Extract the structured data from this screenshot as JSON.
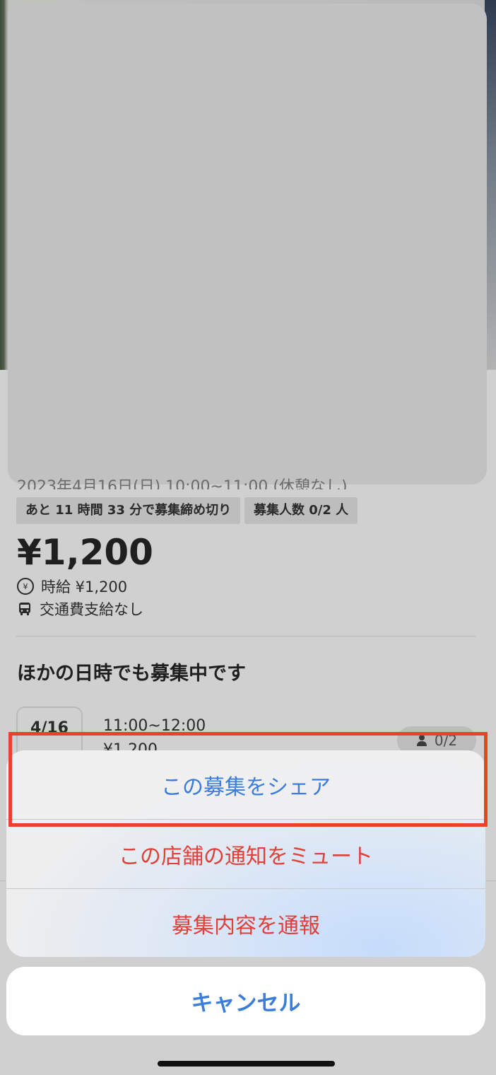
{
  "background_page": {
    "schedule_partial": "2023年4月16日(日) 10:00~11:00 (休憩なし)",
    "tags": {
      "deadline": "あと 11 時間 33 分で募集締め切り",
      "capacity": "募集人数 0/2 人"
    },
    "price": "¥1,200",
    "hourly_wage": "時給 ¥1,200",
    "transport": "交通費支給なし",
    "other_dates_title": "ほかの日時でも募集中です",
    "slot": {
      "date": "4/16",
      "time": "11:00~12:00",
      "wage": "¥1,200",
      "count": "0/2"
    }
  },
  "action_sheet": {
    "share_label": "この募集をシェア",
    "mute_label": "この店舗の通知をミュート",
    "report_label": "募集内容を通報",
    "cancel_label": "キャンセル"
  },
  "colors": {
    "accent_blue": "#3b7ddb",
    "destructive_red": "#e0403a",
    "highlight_border": "#e8432a"
  }
}
